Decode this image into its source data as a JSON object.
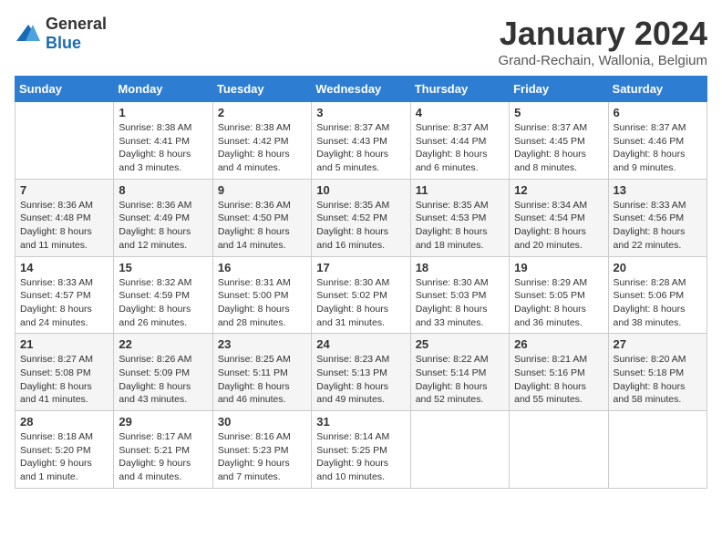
{
  "header": {
    "logo_general": "General",
    "logo_blue": "Blue",
    "title": "January 2024",
    "subtitle": "Grand-Rechain, Wallonia, Belgium"
  },
  "days_of_week": [
    "Sunday",
    "Monday",
    "Tuesday",
    "Wednesday",
    "Thursday",
    "Friday",
    "Saturday"
  ],
  "weeks": [
    [
      {
        "day": "",
        "info": ""
      },
      {
        "day": "1",
        "info": "Sunrise: 8:38 AM\nSunset: 4:41 PM\nDaylight: 8 hours\nand 3 minutes."
      },
      {
        "day": "2",
        "info": "Sunrise: 8:38 AM\nSunset: 4:42 PM\nDaylight: 8 hours\nand 4 minutes."
      },
      {
        "day": "3",
        "info": "Sunrise: 8:37 AM\nSunset: 4:43 PM\nDaylight: 8 hours\nand 5 minutes."
      },
      {
        "day": "4",
        "info": "Sunrise: 8:37 AM\nSunset: 4:44 PM\nDaylight: 8 hours\nand 6 minutes."
      },
      {
        "day": "5",
        "info": "Sunrise: 8:37 AM\nSunset: 4:45 PM\nDaylight: 8 hours\nand 8 minutes."
      },
      {
        "day": "6",
        "info": "Sunrise: 8:37 AM\nSunset: 4:46 PM\nDaylight: 8 hours\nand 9 minutes."
      }
    ],
    [
      {
        "day": "7",
        "info": "Sunrise: 8:36 AM\nSunset: 4:48 PM\nDaylight: 8 hours\nand 11 minutes."
      },
      {
        "day": "8",
        "info": "Sunrise: 8:36 AM\nSunset: 4:49 PM\nDaylight: 8 hours\nand 12 minutes."
      },
      {
        "day": "9",
        "info": "Sunrise: 8:36 AM\nSunset: 4:50 PM\nDaylight: 8 hours\nand 14 minutes."
      },
      {
        "day": "10",
        "info": "Sunrise: 8:35 AM\nSunset: 4:52 PM\nDaylight: 8 hours\nand 16 minutes."
      },
      {
        "day": "11",
        "info": "Sunrise: 8:35 AM\nSunset: 4:53 PM\nDaylight: 8 hours\nand 18 minutes."
      },
      {
        "day": "12",
        "info": "Sunrise: 8:34 AM\nSunset: 4:54 PM\nDaylight: 8 hours\nand 20 minutes."
      },
      {
        "day": "13",
        "info": "Sunrise: 8:33 AM\nSunset: 4:56 PM\nDaylight: 8 hours\nand 22 minutes."
      }
    ],
    [
      {
        "day": "14",
        "info": "Sunrise: 8:33 AM\nSunset: 4:57 PM\nDaylight: 8 hours\nand 24 minutes."
      },
      {
        "day": "15",
        "info": "Sunrise: 8:32 AM\nSunset: 4:59 PM\nDaylight: 8 hours\nand 26 minutes."
      },
      {
        "day": "16",
        "info": "Sunrise: 8:31 AM\nSunset: 5:00 PM\nDaylight: 8 hours\nand 28 minutes."
      },
      {
        "day": "17",
        "info": "Sunrise: 8:30 AM\nSunset: 5:02 PM\nDaylight: 8 hours\nand 31 minutes."
      },
      {
        "day": "18",
        "info": "Sunrise: 8:30 AM\nSunset: 5:03 PM\nDaylight: 8 hours\nand 33 minutes."
      },
      {
        "day": "19",
        "info": "Sunrise: 8:29 AM\nSunset: 5:05 PM\nDaylight: 8 hours\nand 36 minutes."
      },
      {
        "day": "20",
        "info": "Sunrise: 8:28 AM\nSunset: 5:06 PM\nDaylight: 8 hours\nand 38 minutes."
      }
    ],
    [
      {
        "day": "21",
        "info": "Sunrise: 8:27 AM\nSunset: 5:08 PM\nDaylight: 8 hours\nand 41 minutes."
      },
      {
        "day": "22",
        "info": "Sunrise: 8:26 AM\nSunset: 5:09 PM\nDaylight: 8 hours\nand 43 minutes."
      },
      {
        "day": "23",
        "info": "Sunrise: 8:25 AM\nSunset: 5:11 PM\nDaylight: 8 hours\nand 46 minutes."
      },
      {
        "day": "24",
        "info": "Sunrise: 8:23 AM\nSunset: 5:13 PM\nDaylight: 8 hours\nand 49 minutes."
      },
      {
        "day": "25",
        "info": "Sunrise: 8:22 AM\nSunset: 5:14 PM\nDaylight: 8 hours\nand 52 minutes."
      },
      {
        "day": "26",
        "info": "Sunrise: 8:21 AM\nSunset: 5:16 PM\nDaylight: 8 hours\nand 55 minutes."
      },
      {
        "day": "27",
        "info": "Sunrise: 8:20 AM\nSunset: 5:18 PM\nDaylight: 8 hours\nand 58 minutes."
      }
    ],
    [
      {
        "day": "28",
        "info": "Sunrise: 8:18 AM\nSunset: 5:20 PM\nDaylight: 9 hours\nand 1 minute."
      },
      {
        "day": "29",
        "info": "Sunrise: 8:17 AM\nSunset: 5:21 PM\nDaylight: 9 hours\nand 4 minutes."
      },
      {
        "day": "30",
        "info": "Sunrise: 8:16 AM\nSunset: 5:23 PM\nDaylight: 9 hours\nand 7 minutes."
      },
      {
        "day": "31",
        "info": "Sunrise: 8:14 AM\nSunset: 5:25 PM\nDaylight: 9 hours\nand 10 minutes."
      },
      {
        "day": "",
        "info": ""
      },
      {
        "day": "",
        "info": ""
      },
      {
        "day": "",
        "info": ""
      }
    ]
  ]
}
